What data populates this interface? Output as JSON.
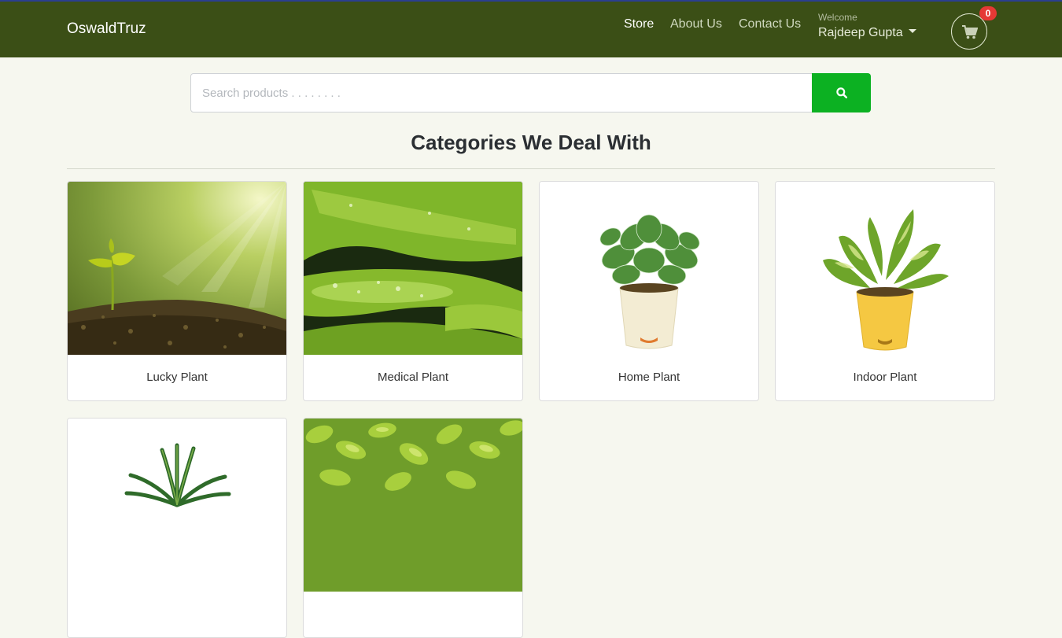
{
  "navbar": {
    "brand": "OswaldTruz",
    "links": [
      {
        "label": "Store",
        "active": true
      },
      {
        "label": "About Us",
        "active": false
      },
      {
        "label": "Contact Us",
        "active": false
      }
    ],
    "welcome_text": "Welcome",
    "user_name": "Rajdeep Gupta",
    "cart_icon": "shopping-cart-icon",
    "cart_count": "0",
    "colors": {
      "navbar_bg": "#3b4f16",
      "badge": "#e53935"
    }
  },
  "search": {
    "placeholder": "Search products . . . . . . . .",
    "value": "",
    "button_icon": "search-icon",
    "button_color": "#0cb122"
  },
  "main": {
    "title": "Categories We Deal With",
    "categories": [
      {
        "label": "Lucky Plant",
        "image": "sprout-in-soil"
      },
      {
        "label": "Medical Plant",
        "image": "aloe-vera-leaves"
      },
      {
        "label": "Home Plant",
        "image": "fittonia-in-cream-pot"
      },
      {
        "label": "Indoor Plant",
        "image": "money-plant-in-yellow-pot"
      },
      {
        "label": "",
        "image": "spider-plant"
      },
      {
        "label": "",
        "image": "green-leafy-shrub"
      }
    ]
  }
}
